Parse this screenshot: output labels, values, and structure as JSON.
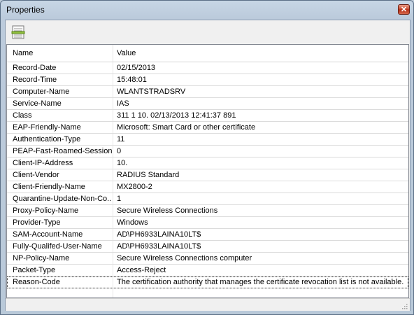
{
  "window": {
    "title": "Properties",
    "close_glyph": "✕"
  },
  "toolbar": {
    "icon": "properties-list-icon"
  },
  "table": {
    "columns": [
      "Name",
      "Value"
    ],
    "rows": [
      {
        "name": "Record-Date",
        "value": "02/15/2013"
      },
      {
        "name": "Record-Time",
        "value": "15:48:01"
      },
      {
        "name": "Computer-Name",
        "value": "WLANTSTRADSRV"
      },
      {
        "name": "Service-Name",
        "value": "IAS"
      },
      {
        "name": "Class",
        "value": "311 1 10.              02/13/2013 12:41:37 891"
      },
      {
        "name": "EAP-Friendly-Name",
        "value": "Microsoft: Smart Card or other certificate"
      },
      {
        "name": "Authentication-Type",
        "value": "11"
      },
      {
        "name": "PEAP-Fast-Roamed-Session",
        "value": "0"
      },
      {
        "name": "Client-IP-Address",
        "value": "10."
      },
      {
        "name": "Client-Vendor",
        "value": "RADIUS Standard"
      },
      {
        "name": "Client-Friendly-Name",
        "value": "MX2800-2"
      },
      {
        "name": "Quarantine-Update-Non-Co...",
        "value": "1"
      },
      {
        "name": "Proxy-Policy-Name",
        "value": "Secure Wireless Connections"
      },
      {
        "name": "Provider-Type",
        "value": "Windows"
      },
      {
        "name": "SAM-Account-Name",
        "value": "AD\\PH6933LAINA10LT$"
      },
      {
        "name": "Fully-Qualifed-User-Name",
        "value": "AD\\PH6933LAINA10LT$"
      },
      {
        "name": "NP-Policy-Name",
        "value": "Secure Wireless Connections computer"
      },
      {
        "name": "Packet-Type",
        "value": "Access-Reject"
      },
      {
        "name": "Reason-Code",
        "value": "The certification authority that manages the certificate revocation list is not available. ..."
      }
    ]
  }
}
